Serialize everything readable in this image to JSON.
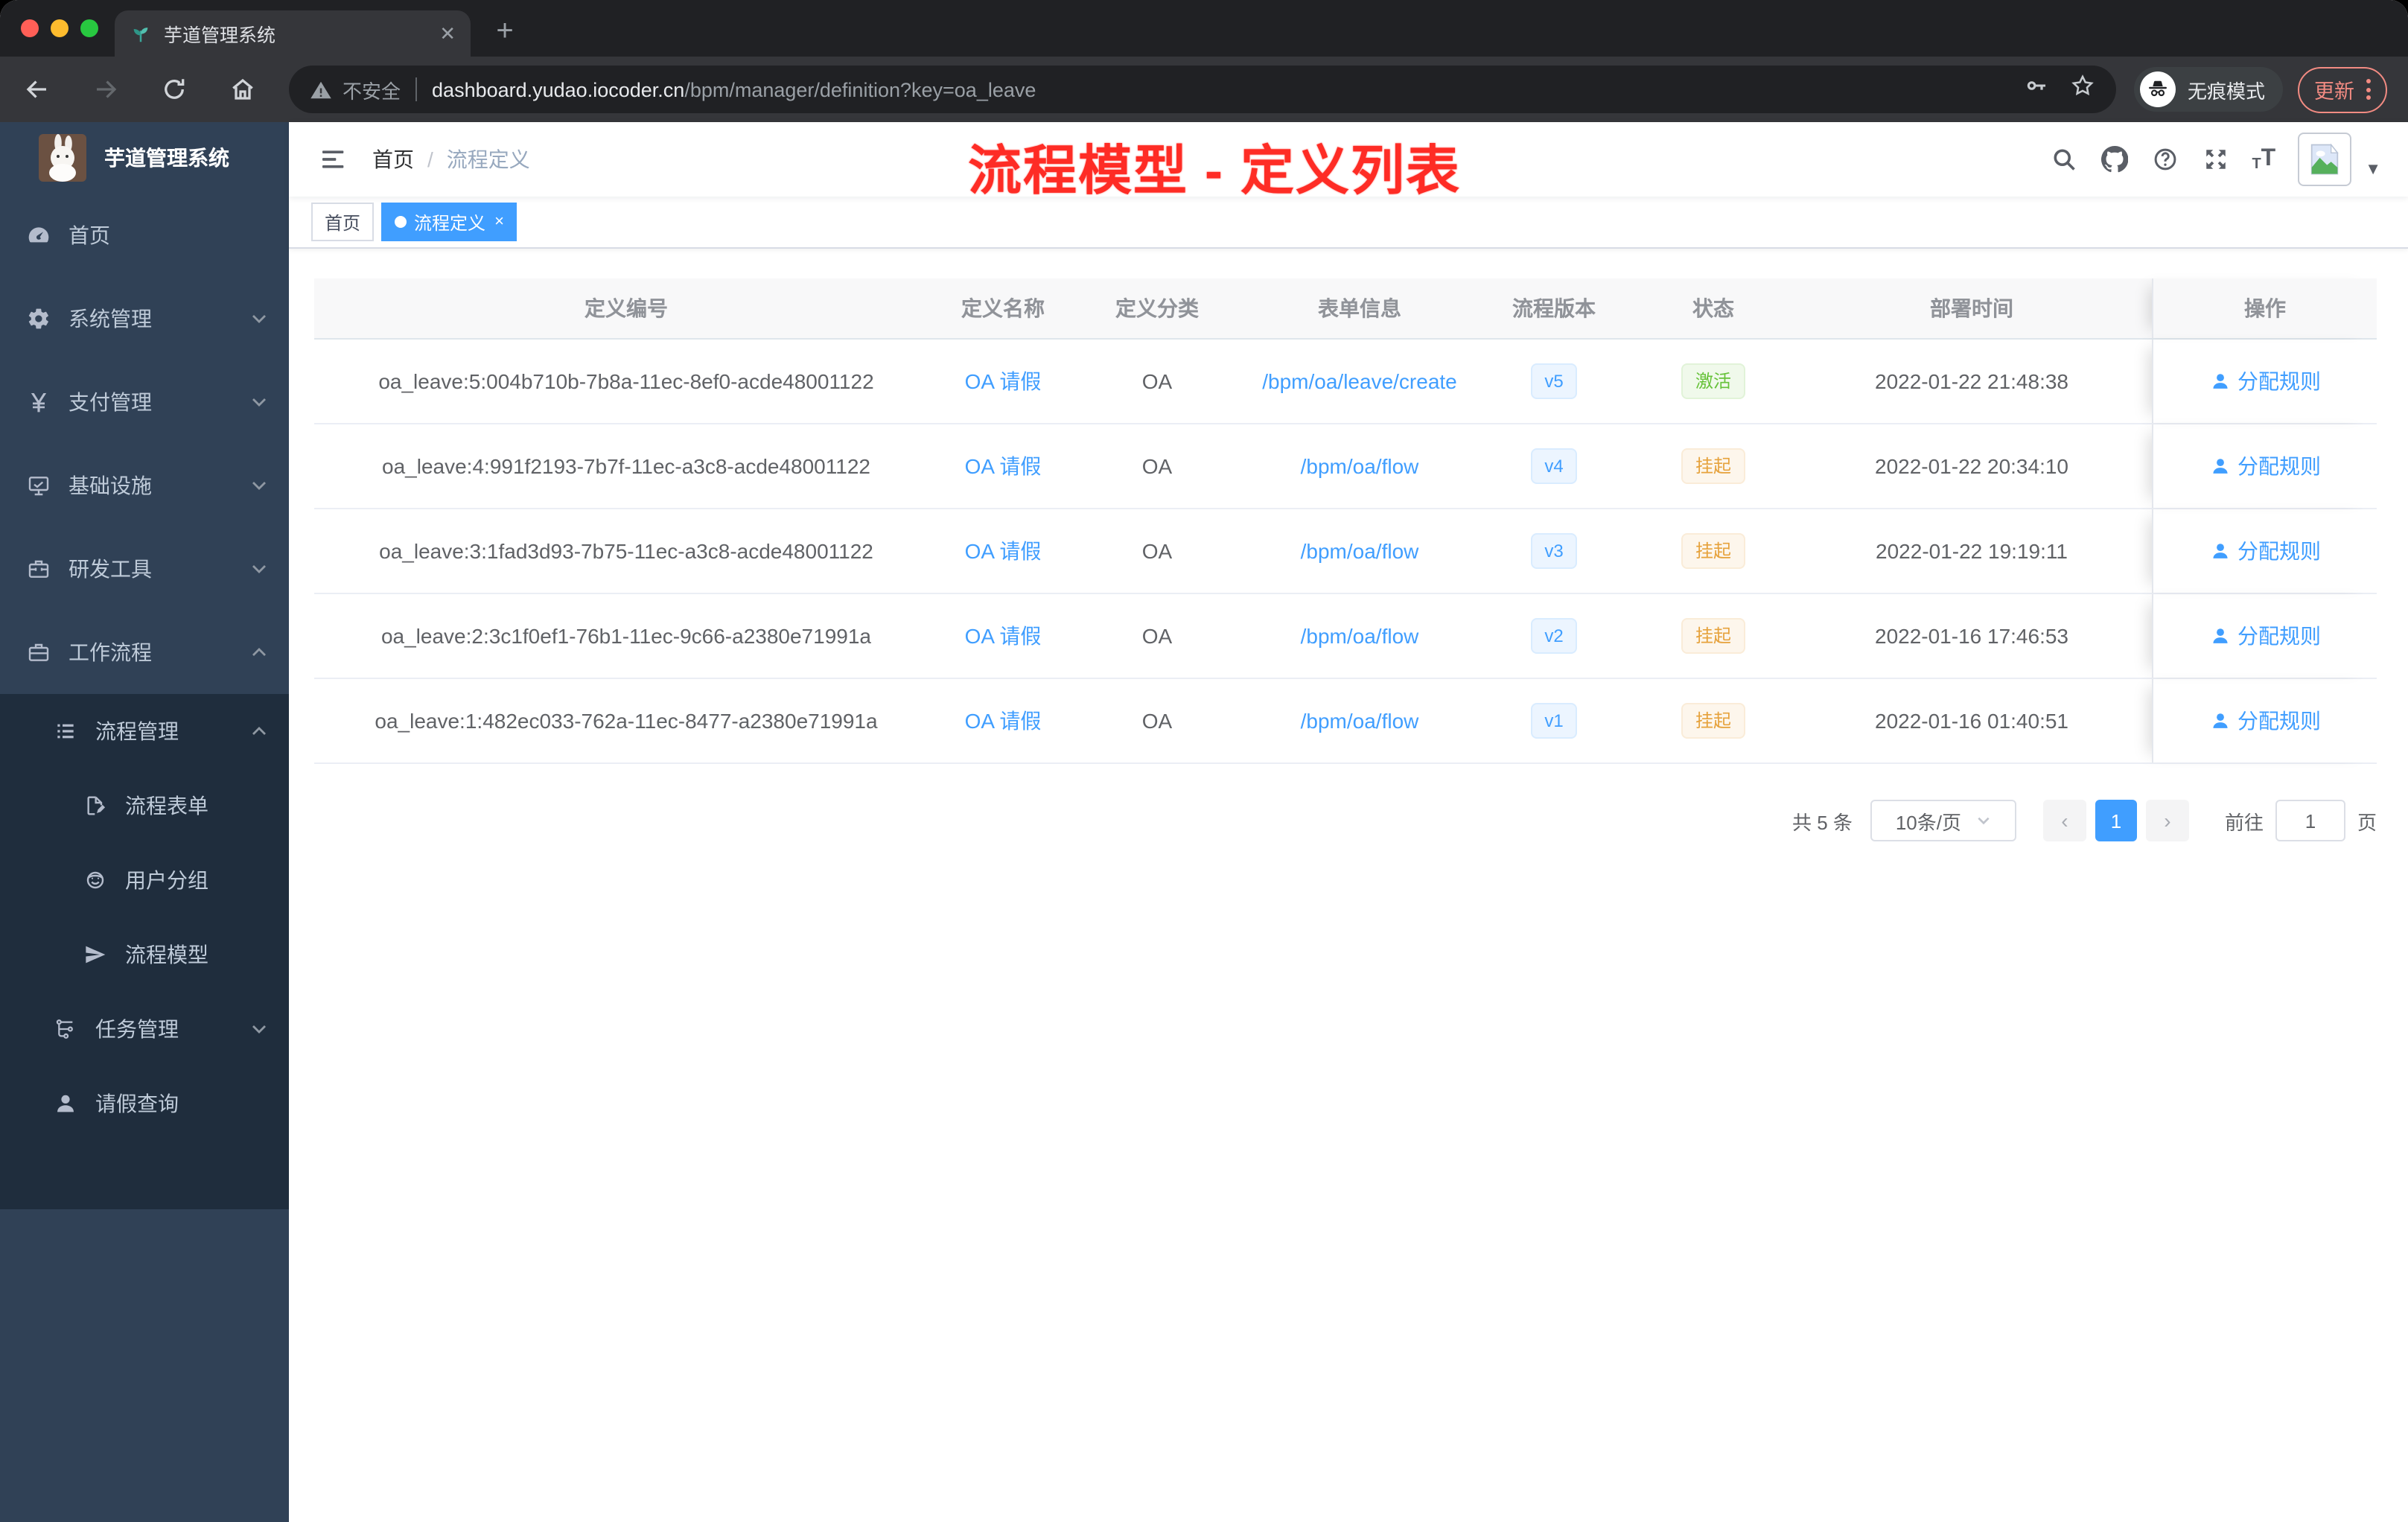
{
  "browser": {
    "tab": {
      "title": "芋道管理系统",
      "close_glyph": "✕",
      "new_tab_glyph": "+"
    },
    "toolbar": {
      "security_label": "不安全",
      "url_domain": "dashboard.yudao.iocoder.cn",
      "url_path": "/bpm/manager/definition?key=oa_leave",
      "incognito_label": "无痕模式",
      "update_label": "更新"
    }
  },
  "sidebar": {
    "logo_title": "芋道管理系统",
    "items": [
      {
        "key": "home",
        "label": "首页",
        "icon": "dashboard-icon",
        "level": 1,
        "dark": false
      },
      {
        "key": "system",
        "label": "系统管理",
        "icon": "gear-icon",
        "level": 1,
        "dark": false,
        "chevron": "down"
      },
      {
        "key": "payment",
        "label": "支付管理",
        "icon": "yen-icon",
        "level": 1,
        "dark": false,
        "chevron": "down"
      },
      {
        "key": "infra",
        "label": "基础设施",
        "icon": "monitor-icon",
        "level": 1,
        "dark": false,
        "chevron": "down"
      },
      {
        "key": "devtools",
        "label": "研发工具",
        "icon": "toolbox-icon",
        "level": 1,
        "dark": false,
        "chevron": "down"
      },
      {
        "key": "workflow",
        "label": "工作流程",
        "icon": "briefcase-icon",
        "level": 1,
        "dark": false,
        "chevron": "up"
      },
      {
        "key": "process-manage",
        "label": "流程管理",
        "icon": "list-icon",
        "level": 2,
        "dark": true,
        "chevron": "up"
      },
      {
        "key": "process-form",
        "label": "流程表单",
        "icon": "form-icon",
        "level": 3,
        "dark": true
      },
      {
        "key": "user-group",
        "label": "用户分组",
        "icon": "group-icon",
        "level": 3,
        "dark": true
      },
      {
        "key": "process-model",
        "label": "流程模型",
        "icon": "model-icon",
        "level": 3,
        "dark": true
      },
      {
        "key": "task-manage",
        "label": "任务管理",
        "icon": "task-icon",
        "level": 2,
        "dark": true,
        "chevron": "down"
      },
      {
        "key": "leave-query",
        "label": "请假查询",
        "icon": "user-icon",
        "level": 2,
        "dark": true
      }
    ]
  },
  "header": {
    "breadcrumb": {
      "home": "首页",
      "separator": "/",
      "current": "流程定义"
    },
    "annotation": "流程模型 - 定义列表"
  },
  "tags": [
    {
      "key": "home",
      "label": "首页",
      "active": false,
      "closable": false
    },
    {
      "key": "process-definition",
      "label": "流程定义",
      "active": true,
      "closable": true,
      "close_glyph": "×"
    }
  ],
  "table": {
    "columns": [
      "定义编号",
      "定义名称",
      "定义分类",
      "表单信息",
      "流程版本",
      "状态",
      "部署时间",
      "操作"
    ],
    "action_label": "分配规则",
    "rows": [
      {
        "id": "oa_leave:5:004b710b-7b8a-11ec-8ef0-acde48001122",
        "name": "OA 请假",
        "category": "OA",
        "form": "/bpm/oa/leave/create",
        "version": "v5",
        "status": "激活",
        "status_type": "success",
        "time": "2022-01-22 21:48:38"
      },
      {
        "id": "oa_leave:4:991f2193-7b7f-11ec-a3c8-acde48001122",
        "name": "OA 请假",
        "category": "OA",
        "form": "/bpm/oa/flow",
        "version": "v4",
        "status": "挂起",
        "status_type": "warning",
        "time": "2022-01-22 20:34:10"
      },
      {
        "id": "oa_leave:3:1fad3d93-7b75-11ec-a3c8-acde48001122",
        "name": "OA 请假",
        "category": "OA",
        "form": "/bpm/oa/flow",
        "version": "v3",
        "status": "挂起",
        "status_type": "warning",
        "time": "2022-01-22 19:19:11"
      },
      {
        "id": "oa_leave:2:3c1f0ef1-76b1-11ec-9c66-a2380e71991a",
        "name": "OA 请假",
        "category": "OA",
        "form": "/bpm/oa/flow",
        "version": "v2",
        "status": "挂起",
        "status_type": "warning",
        "time": "2022-01-16 17:46:53"
      },
      {
        "id": "oa_leave:1:482ec033-762a-11ec-8477-a2380e71991a",
        "name": "OA 请假",
        "category": "OA",
        "form": "/bpm/oa/flow",
        "version": "v1",
        "status": "挂起",
        "status_type": "warning",
        "time": "2022-01-16 01:40:51"
      }
    ]
  },
  "pagination": {
    "total": "共 5 条",
    "page_size": "10条/页",
    "prev": "‹",
    "current": "1",
    "next": "›",
    "goto": "前往",
    "goto_value": "1",
    "unit": "页"
  },
  "colors": {
    "accent": "#409eff",
    "success": "#67c23a",
    "warning": "#e6a23c",
    "sidebar_bg": "#304156",
    "sidebar_sub_bg": "#1f2d3d",
    "annotation": "#fe2c25"
  }
}
